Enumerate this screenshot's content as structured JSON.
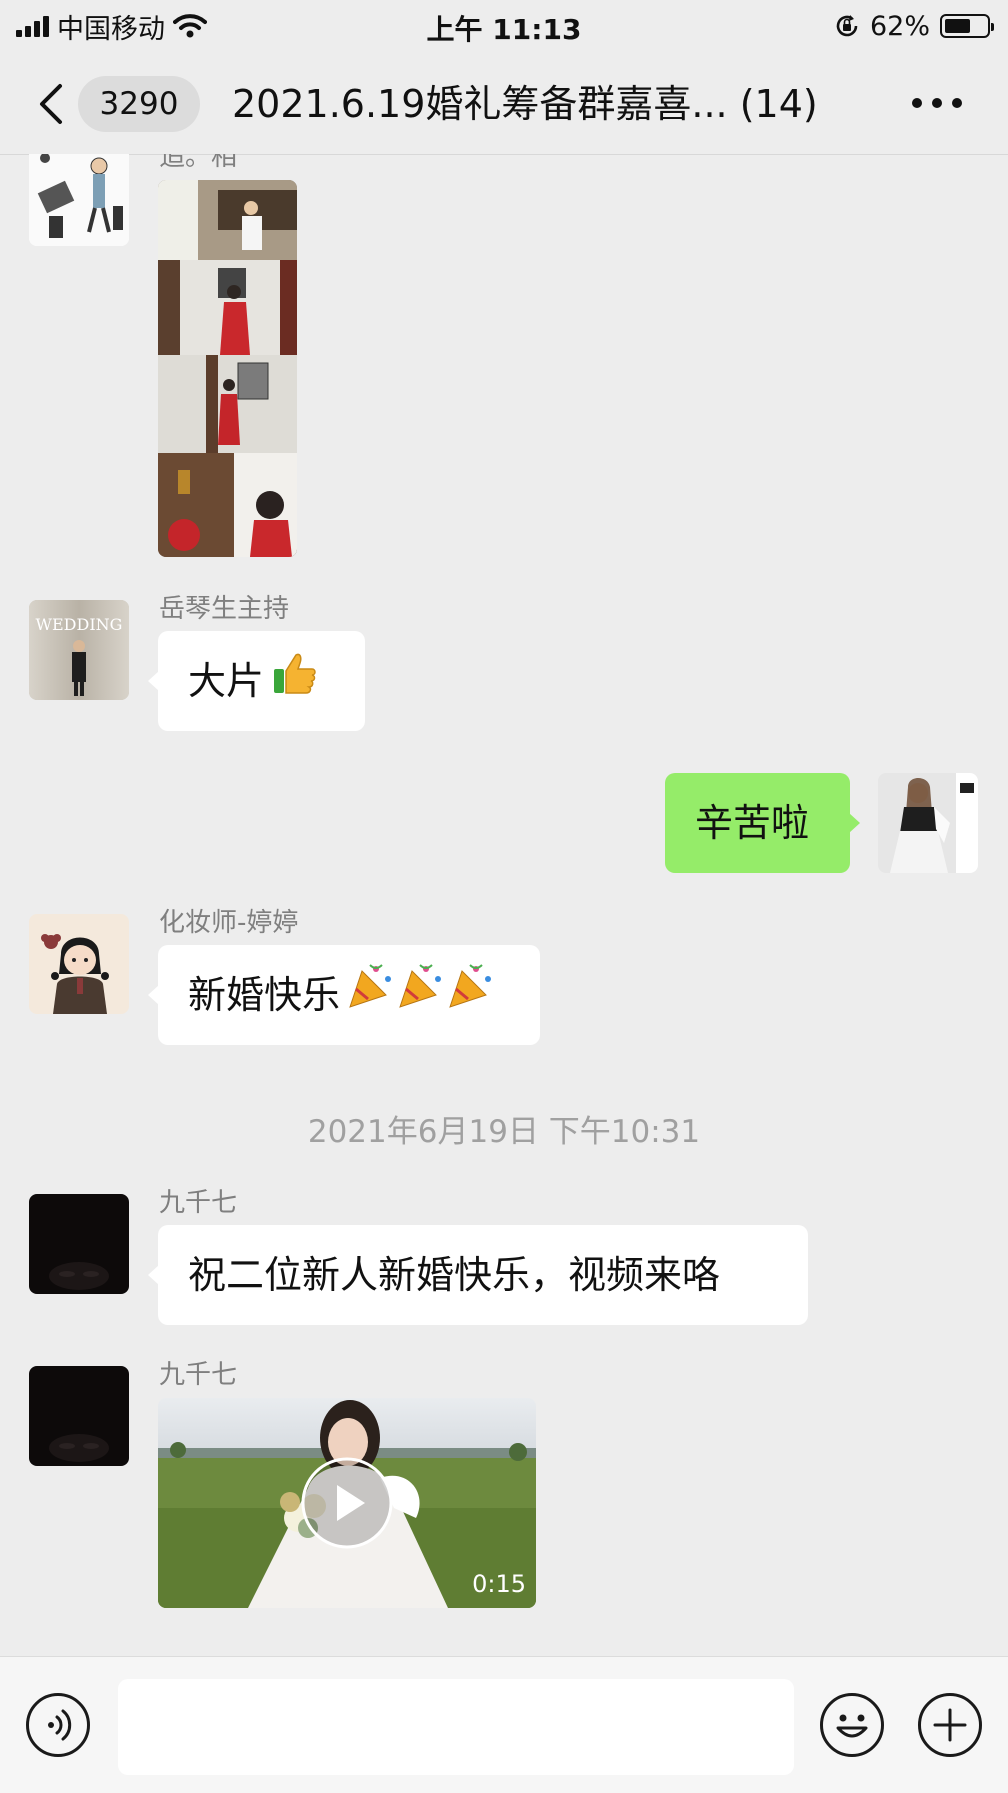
{
  "status_bar": {
    "carrier": "中国移动",
    "time": "上午 11:13",
    "battery_text": "62%",
    "battery_level": 0.62
  },
  "header": {
    "unread_count": "3290",
    "title": "2021.6.19婚礼筹备群嘉喜... (14)",
    "icons": [
      "chevron-left-icon",
      "more-dots-icon"
    ]
  },
  "messages": [
    {
      "type": "image",
      "sender": "",
      "partial_caption": "追。相",
      "direction": "incoming"
    },
    {
      "type": "text",
      "sender": "岳琴生主持",
      "text": "大片",
      "emoji": "thumbs-up",
      "direction": "incoming"
    },
    {
      "type": "text",
      "sender": "",
      "text": "辛苦啦",
      "direction": "outgoing"
    },
    {
      "type": "text",
      "sender": "化妆师-婷婷",
      "text": "新婚快乐",
      "emoji": "party-popper x3",
      "direction": "incoming"
    },
    {
      "type": "timestamp",
      "text": "2021年6月19日 下午10:31"
    },
    {
      "type": "text",
      "sender": "九千七",
      "text": "祝二位新人新婚快乐，视频来咯",
      "direction": "incoming"
    },
    {
      "type": "video",
      "sender": "九千七",
      "duration": "0:15",
      "direction": "incoming"
    }
  ],
  "input_bar": {
    "value": "",
    "icons": [
      "voice-icon",
      "emoji-face-icon",
      "plus-icon"
    ]
  },
  "colors": {
    "background": "#ededed",
    "incoming_bubble": "#ffffff",
    "outgoing_bubble": "#95ec69",
    "meta_text": "#7f7f7f"
  }
}
